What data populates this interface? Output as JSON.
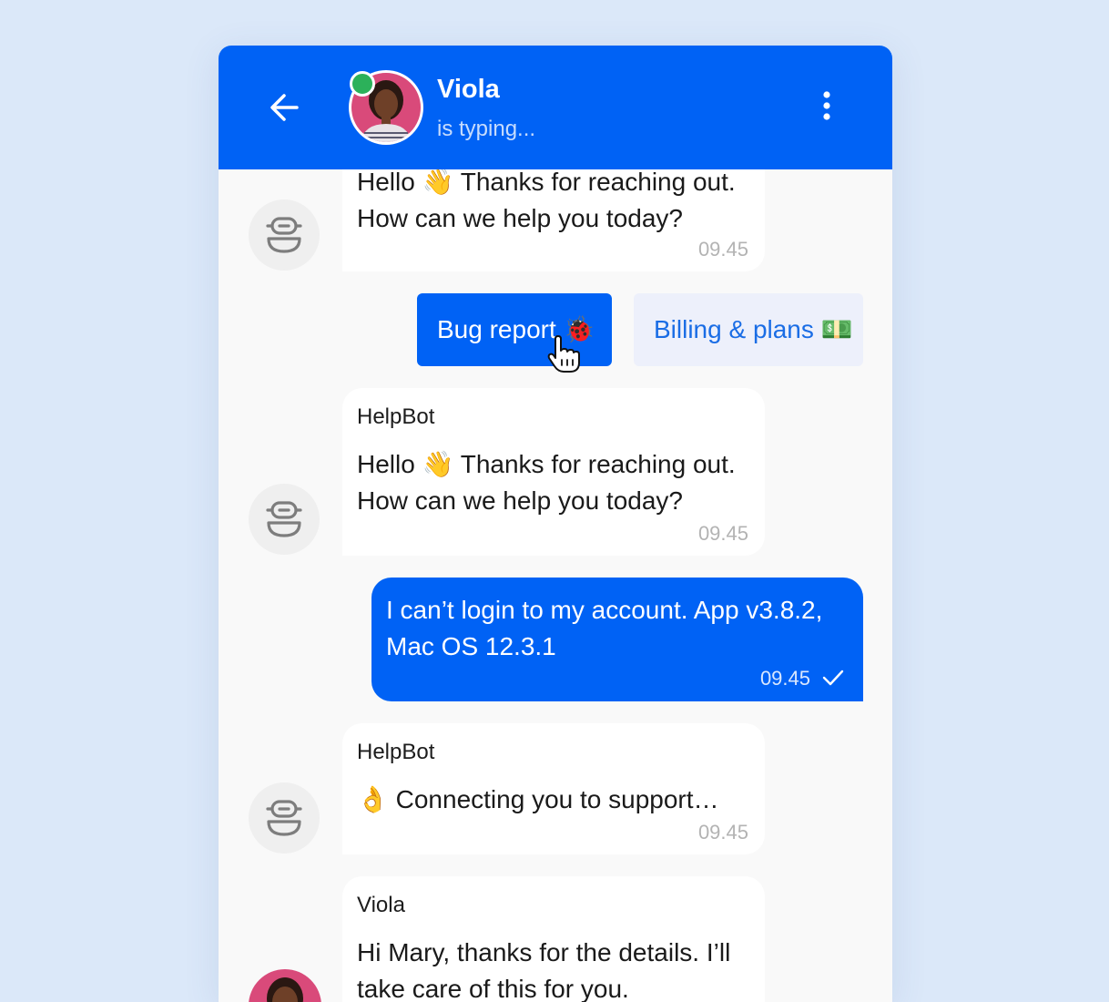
{
  "header": {
    "contact_name": "Viola",
    "status": "is typing...",
    "background_color": "#0062f5",
    "back_icon": "arrow-left-icon",
    "menu_icon": "more-vertical-icon"
  },
  "messages": [
    {
      "sender": "",
      "lines": [
        "Hello 👋 Thanks for reaching out.",
        "How can we help you today?"
      ],
      "time": "09.45"
    },
    {
      "sender": "HelpBot",
      "lines": [
        "Hello 👋 Thanks for reaching out.",
        "How can we help you today?"
      ],
      "time": "09.45"
    },
    {
      "sender": "",
      "lines": [
        "I can’t login to my account. App v3.8.2,",
        "Mac OS 12.3.1"
      ],
      "time": "09.45"
    },
    {
      "sender": "HelpBot",
      "lines": [
        "👌 Connecting you to support…"
      ],
      "time": "09.45"
    },
    {
      "sender": "Viola",
      "lines": [
        "Hi Mary, thanks for the details. I’ll",
        "take care of this for you."
      ],
      "time": ""
    }
  ],
  "quick_replies": {
    "bug_report": "Bug report 🐞",
    "billing": "Billing & plans 💵"
  },
  "colors": {
    "accent": "#0062f5",
    "online": "#2cb15a",
    "page_background": "#dbe8f9"
  }
}
